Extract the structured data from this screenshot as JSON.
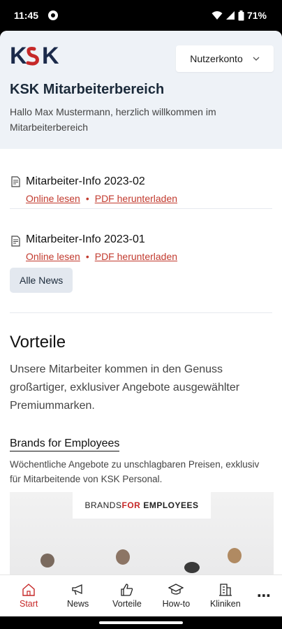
{
  "statusbar": {
    "time": "11:45",
    "battery": "71%"
  },
  "header": {
    "logo_text": "KSK",
    "account_label": "Nutzerkonto",
    "title": "KSK Mitarbeiterbereich",
    "subtitle": "Hallo Max Mustermann, herzlich willkommen im Mitarbeiterbereich"
  },
  "news": {
    "items": [
      {
        "title": "Mitarbeiter-Info 2023-02",
        "read_label": "Online lesen",
        "download_label": "PDF herunterladen"
      },
      {
        "title": "Mitarbeiter-Info 2023-01",
        "read_label": "Online lesen",
        "download_label": "PDF herunterladen"
      }
    ],
    "all_news_label": "Alle News"
  },
  "vorteile": {
    "title": "Vorteile",
    "text": "Unsere Mitarbeiter kommen in den Genuss großartiger, exklusiver Angebote ausgewählter Premiummarken.",
    "brand_title": "Brands for Employees",
    "brand_text": "Wöchentliche Angebote zu unschlagbaren Preisen, exklusiv für Mitarbeitende von KSK Personal.",
    "banner_part1": "BRANDS ",
    "banner_part2": "FOR",
    "banner_part3": "EMPLOYEES"
  },
  "bottomnav": {
    "items": [
      {
        "label": "Start",
        "icon": "home-icon",
        "active": true
      },
      {
        "label": "News",
        "icon": "megaphone-icon",
        "active": false
      },
      {
        "label": "Vorteile",
        "icon": "thumbs-up-icon",
        "active": false
      },
      {
        "label": "How-to",
        "icon": "graduation-cap-icon",
        "active": false
      },
      {
        "label": "Kliniken",
        "icon": "building-icon",
        "active": false
      }
    ],
    "more_label": "⋯"
  },
  "colors": {
    "accent_red": "#c62828",
    "logo_blue": "#1b2a4a",
    "header_bg": "#eef2f7"
  }
}
